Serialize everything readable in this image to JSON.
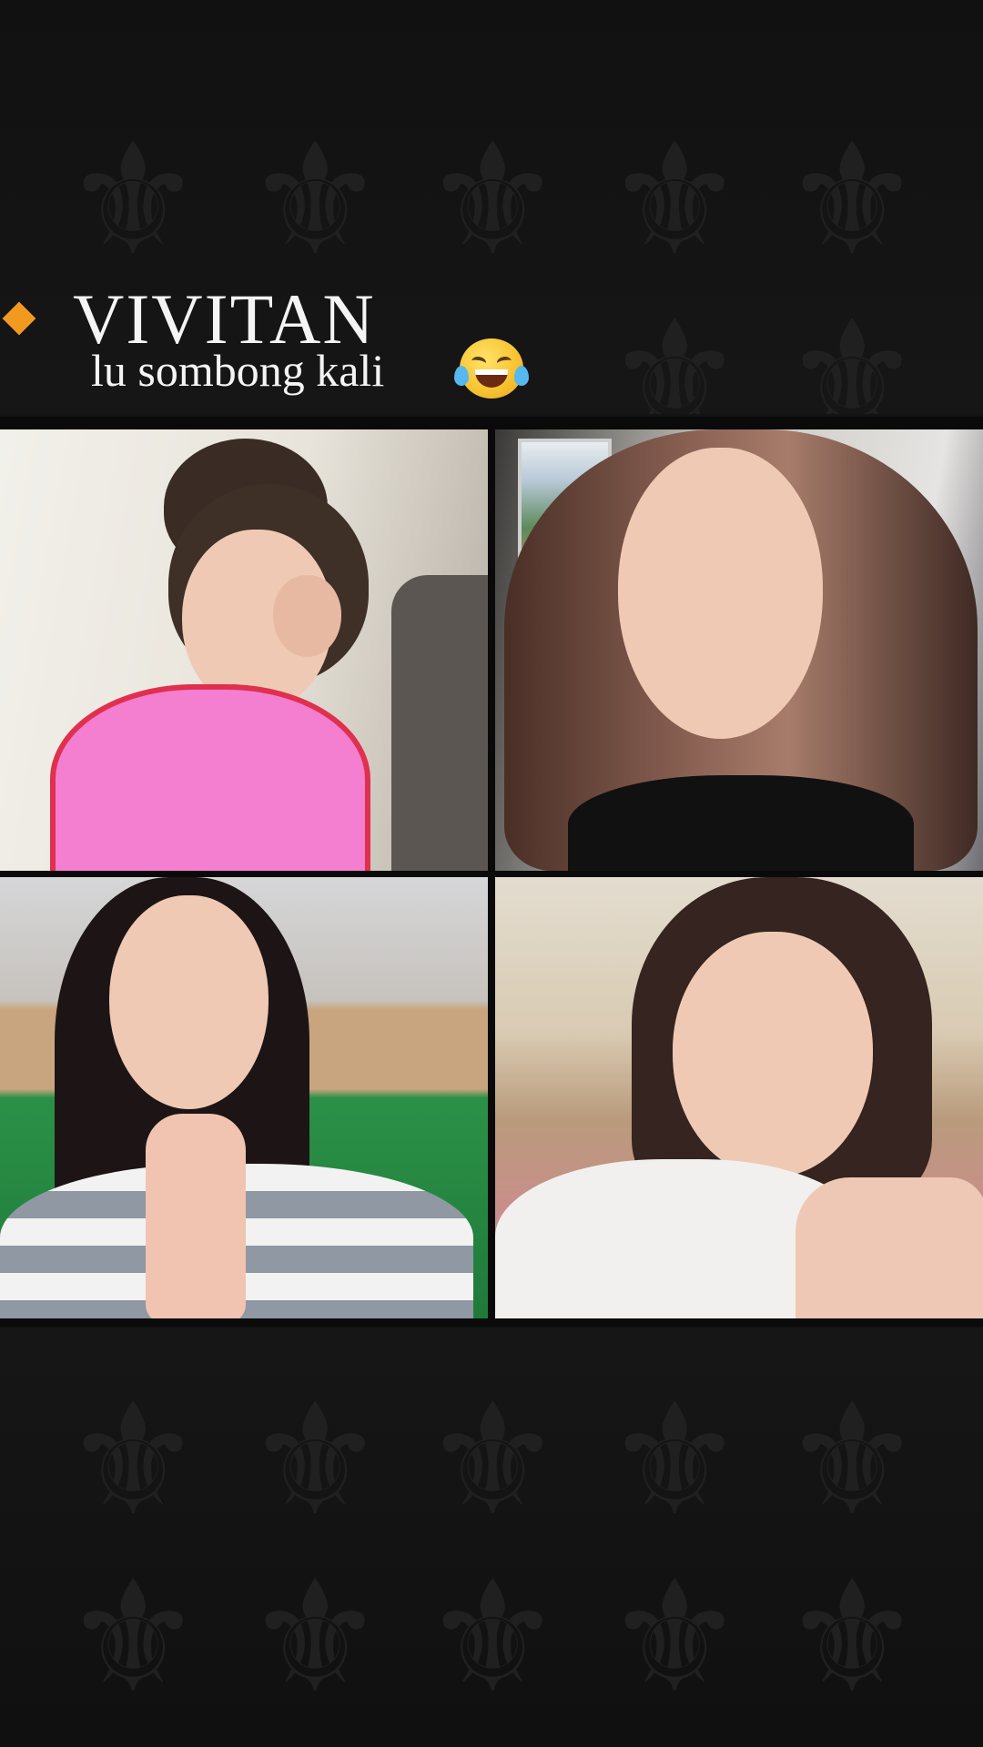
{
  "caption": {
    "name": "VIVITAN",
    "message": "lu sombong kali"
  },
  "colors": {
    "background": "#131313",
    "accent_diamond": "#f29a1f",
    "text": "#f4f4f4"
  },
  "icons": {
    "bullet": "orange-diamond-icon",
    "reaction": "tears-of-joy-emoji"
  },
  "video_tiles": [
    {
      "position": "top-left",
      "shirt_color": "#f47fd0"
    },
    {
      "position": "top-right",
      "shirt_color": "#111111"
    },
    {
      "position": "bottom-left",
      "shirt_color": "#8f98a3"
    },
    {
      "position": "bottom-right",
      "shirt_color": "#f2f0ee"
    }
  ]
}
